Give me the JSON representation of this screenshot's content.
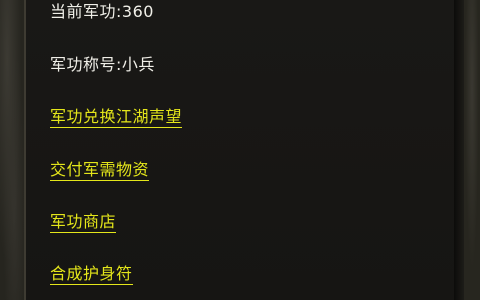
{
  "panel": {
    "info": [
      {
        "label": "当前军功:",
        "value": "360"
      },
      {
        "label": "军功称号:",
        "value": "小兵"
      }
    ],
    "links": [
      {
        "label": "军功兑换江湖声望"
      },
      {
        "label": "交付军需物资"
      },
      {
        "label": "军功商店"
      },
      {
        "label": "合成护身符"
      }
    ]
  },
  "colors": {
    "info_text": "#f0efe8",
    "link_text": "#e4e61a",
    "panel_bg": "#191816"
  }
}
